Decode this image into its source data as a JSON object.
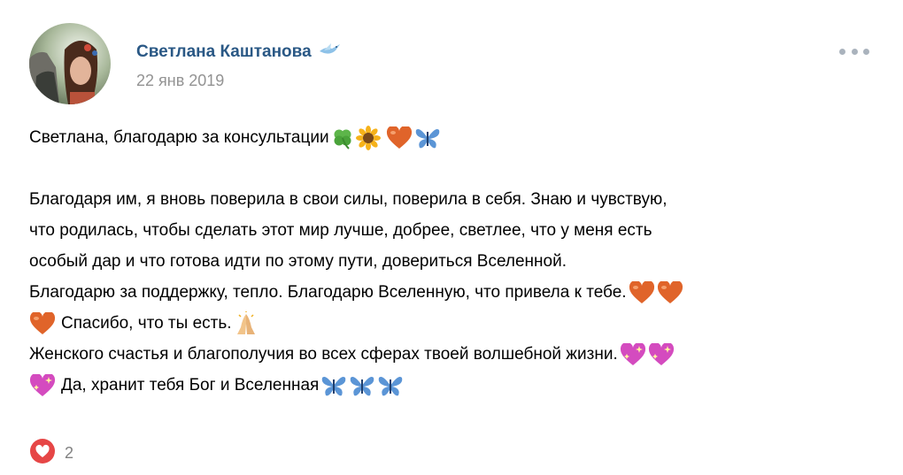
{
  "post": {
    "author": "Светлана Каштанова",
    "date": "22 янв 2019",
    "lines": [
      "Светлана, благодарю за консультации",
      "",
      "Благодаря им, я вновь поверила в свои силы, поверила в себя. Знаю и чувствую,",
      "что родилась, чтобы сделать этот мир лучше, добрее, светлее, что у меня есть",
      "особый дар и что готова идти по этому пути, довериться Вселенной.",
      "Благодарю за поддержку, тепло. Благодарю Вселенную, что привела к тебе.",
      " Спасибо, что ты есть.",
      "Женского счастья и благополучия во всех сферах твоей волшебной жизни.",
      " Да, хранит тебя Бог и Вселенная"
    ]
  },
  "likes": {
    "count": "2"
  },
  "icons": {
    "author_badge": "blue-bird-icon",
    "menu": "more-options-icon",
    "like": "heart-icon",
    "emoji": [
      "four-leaf-clover-icon",
      "sunflower-icon",
      "orange-heart-icon",
      "butterfly-icon",
      "folded-hands-icon",
      "sparkling-heart-icon"
    ]
  },
  "colors": {
    "author_link": "#2a5885",
    "date": "#939393",
    "like_heart": "#e64646",
    "like_count": "#828282"
  }
}
